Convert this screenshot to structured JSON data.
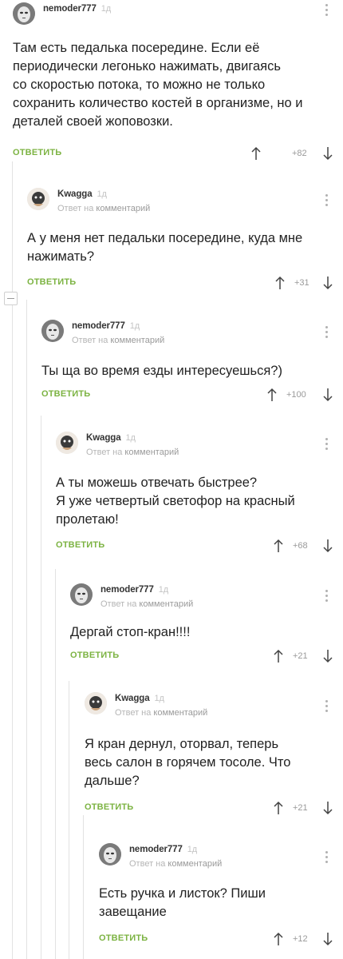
{
  "reply_label": "ОТВЕТИТЬ",
  "reply_to_prefix": "Ответ на",
  "reply_to_word": "комментарий",
  "comments": [
    {
      "author": "nemoder777",
      "age": "1д",
      "lines": [
        "Там есть педалька посередине. Если её",
        "периодически легонько нажимать, двигаясь",
        "со скоростью потока, то можно не только",
        "сохранить количество костей в организме, но и",
        "деталей своей жоповозки."
      ],
      "votes": "+82"
    },
    {
      "author": "Kwagga",
      "age": "1д",
      "lines": [
        "А у меня нет педальки посередине, куда мне",
        "нажимать?"
      ],
      "votes": "+31"
    },
    {
      "author": "nemoder777",
      "age": "1д",
      "lines": [
        "Ты ща во время езды интересуешься?)"
      ],
      "votes": "+100"
    },
    {
      "author": "Kwagga",
      "age": "1д",
      "lines": [
        "А ты можешь отвечать быстрее?",
        "Я уже четвертый светофор на красный",
        "пролетаю!"
      ],
      "votes": "+68"
    },
    {
      "author": "nemoder777",
      "age": "1д",
      "lines": [
        "Дергай стоп-кран!!!!"
      ],
      "votes": "+21"
    },
    {
      "author": "Kwagga",
      "age": "1д",
      "lines": [
        "Я кран дернул, оторвал, теперь",
        "весь салон в горячем тосоле. Что",
        "дальше?"
      ],
      "votes": "+21"
    },
    {
      "author": "nemoder777",
      "age": "1д",
      "lines": [
        "Есть ручка и листок? Пиши",
        "завещание"
      ],
      "votes": "+12"
    }
  ]
}
